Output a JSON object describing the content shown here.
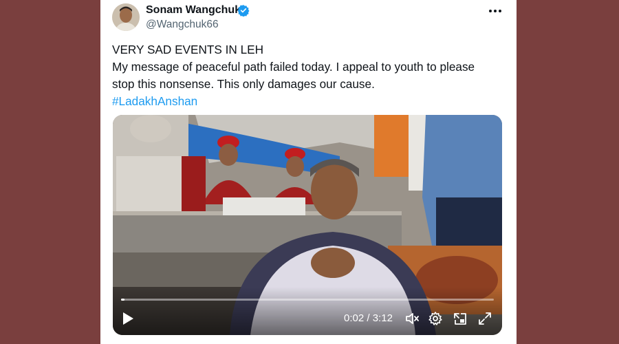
{
  "tweet": {
    "author": {
      "name": "Sonam Wangchuk",
      "handle": "@Wangchuk66",
      "verified": true
    },
    "text_lines": [
      "VERY SAD EVENTS IN LEH",
      "My message of peaceful path failed today. I appeal to youth to please",
      "stop this nonsense. This only damages our cause."
    ],
    "hashtag": "#LadakhAnshan"
  },
  "video": {
    "current_time": "0:02",
    "separator": "/",
    "duration": "3:12",
    "progress_fraction": 0.01,
    "icons": [
      "play-icon",
      "mute-icon",
      "settings-icon",
      "pip-icon",
      "fullscreen-icon"
    ]
  },
  "colors": {
    "background": "#7a3f3e",
    "card": "#ffffff",
    "text": "#0f1419",
    "handle": "#536471",
    "link": "#1d9bf0",
    "verified": "#1d9bf0"
  }
}
